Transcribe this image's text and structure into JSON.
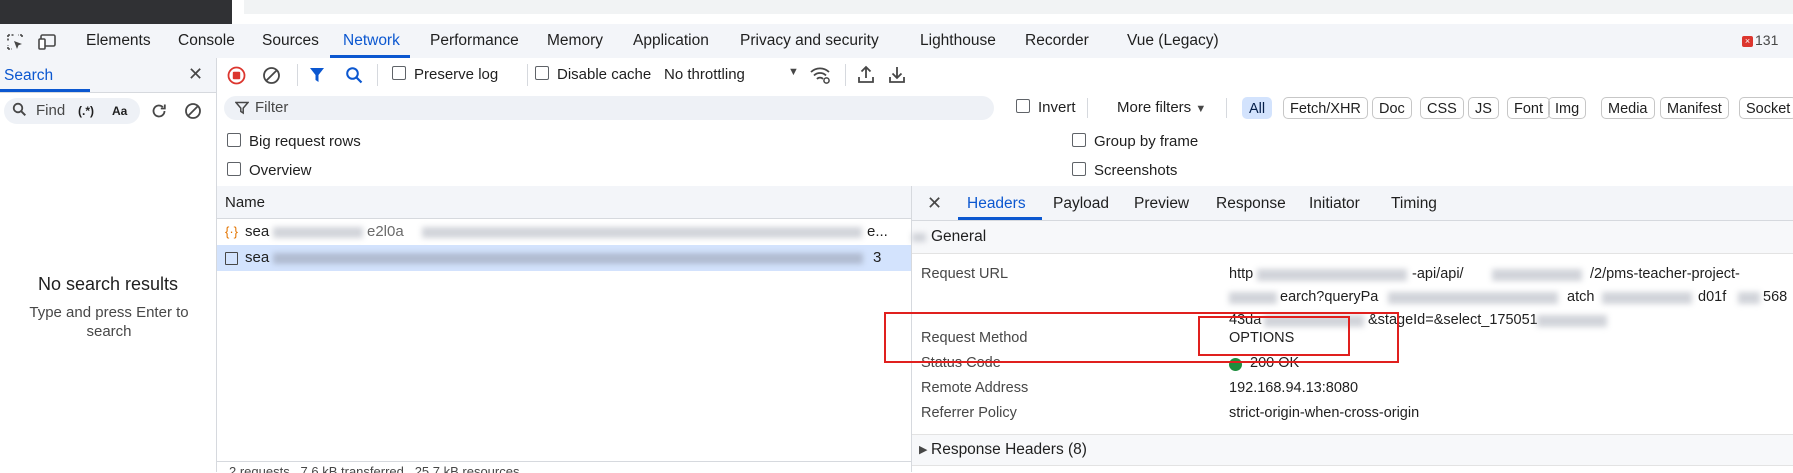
{
  "devtools": {
    "tabs": [
      "Elements",
      "Console",
      "Sources",
      "Network",
      "Performance",
      "Memory",
      "Application",
      "Privacy and security",
      "Lighthouse",
      "Recorder",
      "Vue (Legacy)"
    ],
    "active_tab": "Network",
    "error_count": "131"
  },
  "search_panel": {
    "title": "Search",
    "find_placeholder": "Find",
    "regex_label": "(.*)",
    "case_label": "Aa",
    "no_results": "No search results",
    "hint": "Type and press Enter to search"
  },
  "toolbar": {
    "preserve_log": "Preserve log",
    "disable_cache": "Disable cache",
    "throttling": "No throttling"
  },
  "filter_bar": {
    "placeholder": "Filter",
    "invert": "Invert",
    "more_filters": "More filters",
    "types": [
      "All",
      "Fetch/XHR",
      "Doc",
      "CSS",
      "JS",
      "Font",
      "Img",
      "Media",
      "Manifest",
      "Socket"
    ],
    "active_type": "All"
  },
  "options": {
    "big_request_rows": "Big request rows",
    "overview": "Overview",
    "group_by_frame": "Group by frame",
    "screenshots": "Screenshots"
  },
  "requests": {
    "column_name": "Name",
    "rows": [
      {
        "name_prefix": "sea",
        "name_visible": "e2l0a",
        "suffix": "e..."
      },
      {
        "name_prefix": "sea",
        "name_visible": "",
        "suffix": "3"
      }
    ],
    "status_bar": "2 requests   7.6 kB transferred   25.7 kB resources"
  },
  "details": {
    "tabs": [
      "Headers",
      "Payload",
      "Preview",
      "Response",
      "Initiator",
      "Timing"
    ],
    "active_tab": "Headers",
    "general_label": "General",
    "request_url_label": "Request URL",
    "request_url_value_start": "http",
    "request_url_fragment_1": "-api/api/",
    "request_url_fragment_2": "/2/pms-teacher-project-",
    "request_url_line2_a": "earch?queryPa",
    "request_url_line2_b": "atch",
    "request_url_line2_c": "d01f",
    "request_url_line2_d": "568",
    "request_url_line3_a": "43da",
    "request_url_line3_b": "&stageId=&select_175051",
    "request_method_label": "Request Method",
    "request_method_value": "OPTIONS",
    "status_code_label": "Status Code",
    "status_code_value": "200 OK",
    "remote_address_label": "Remote Address",
    "remote_address_value": "192.168.94.13:8080",
    "referrer_policy_label": "Referrer Policy",
    "referrer_policy_value": "strict-origin-when-cross-origin",
    "response_headers_label": "Response Headers (8)"
  },
  "colors": {
    "accent": "#0b57d0",
    "annotation_red": "#e0201e",
    "status_ok": "#1e8e3e",
    "record_red": "#dc362e"
  }
}
